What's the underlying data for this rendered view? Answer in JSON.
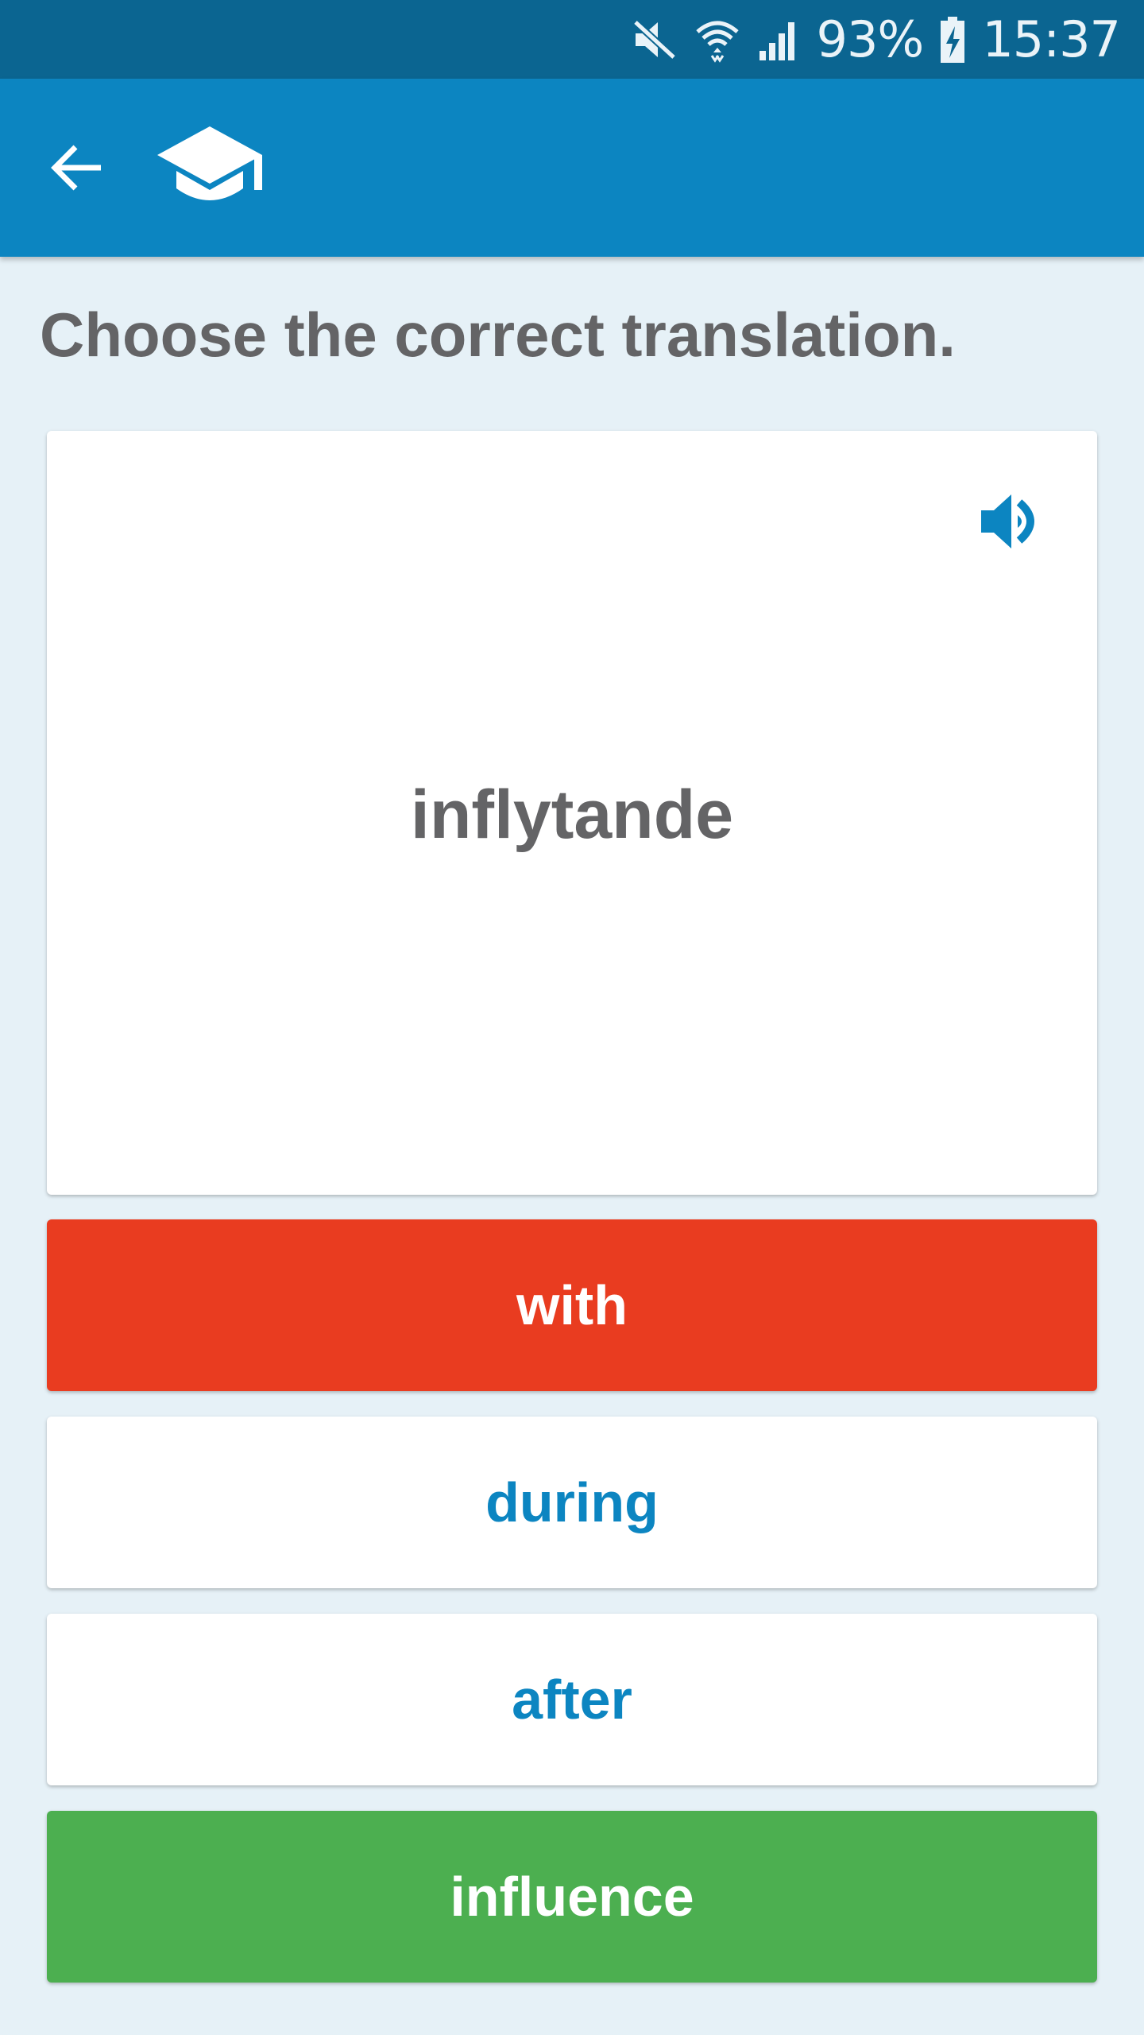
{
  "status_bar": {
    "battery": "93%",
    "time": "15:37",
    "icons": [
      "mute-icon",
      "wifi-icon",
      "signal-icon",
      "battery-charging-icon"
    ]
  },
  "app_bar": {
    "back_icon": "arrow-left-icon",
    "logo_icon": "graduation-cap-icon",
    "color": "#0c85c1"
  },
  "quiz": {
    "prompt": "Choose the correct translation.",
    "word": "inflytande",
    "sound_icon": "speaker-icon",
    "options": [
      {
        "label": "with",
        "state": "wrong",
        "color": "#e93c20"
      },
      {
        "label": "during",
        "state": "neutral",
        "color": "#ffffff"
      },
      {
        "label": "after",
        "state": "neutral",
        "color": "#ffffff"
      },
      {
        "label": "influence",
        "state": "correct",
        "color": "#4caf50"
      }
    ]
  }
}
